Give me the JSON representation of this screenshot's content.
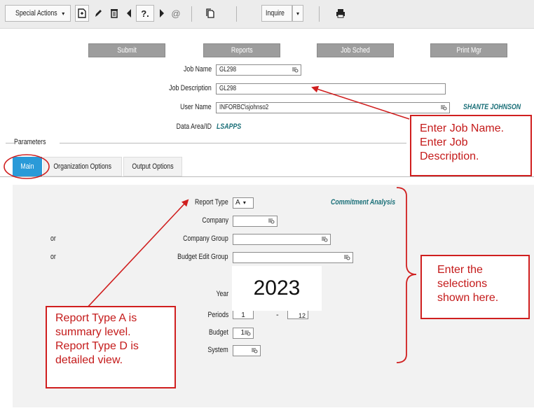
{
  "toolbar": {
    "special_actions": "Special Actions",
    "inquire": "Inquire"
  },
  "actions": {
    "submit": "Submit",
    "reports": "Reports",
    "job_sched": "Job Sched",
    "print_mgr": "Print Mgr"
  },
  "job": {
    "job_name_label": "Job Name",
    "job_name_value": "GL298",
    "job_desc_label": "Job Description",
    "job_desc_value": "GL298",
    "user_name_label": "User Name",
    "user_name_value": "INFORBC\\sjohnso2",
    "user_full_name": "SHANTE JOHNSON",
    "data_area_label": "Data Area/ID",
    "data_area_value": "LSAPPS"
  },
  "parameters": {
    "legend": "Parameters",
    "tabs": [
      "Main",
      "Organization Options",
      "Output Options"
    ],
    "report_type_label": "Report Type",
    "report_type_value": "A",
    "report_type_desc": "Commitment Analysis",
    "company_label": "Company",
    "or_1": "or",
    "company_group_label": "Company Group",
    "or_2": "or",
    "budget_edit_group_label": "Budget Edit Group",
    "year_label": "Year",
    "year_value": "2023",
    "periods_label": "Periods",
    "periods_from": "1",
    "periods_dash": "-",
    "periods_to": "12",
    "budget_label": "Budget",
    "budget_value": "1",
    "system_label": "System"
  },
  "callouts": {
    "job_name": "Enter Job Name.",
    "job_desc": "Enter Job Description.",
    "selections": "Enter the selections shown here.",
    "report_type": "Report Type A is summary level. Report Type D is detailed view."
  },
  "colors": {
    "annotation_red": "#d01f1f",
    "teal_text": "#1a6f78",
    "active_tab": "#2a9ad8",
    "button_gray": "#9d9d9d"
  }
}
